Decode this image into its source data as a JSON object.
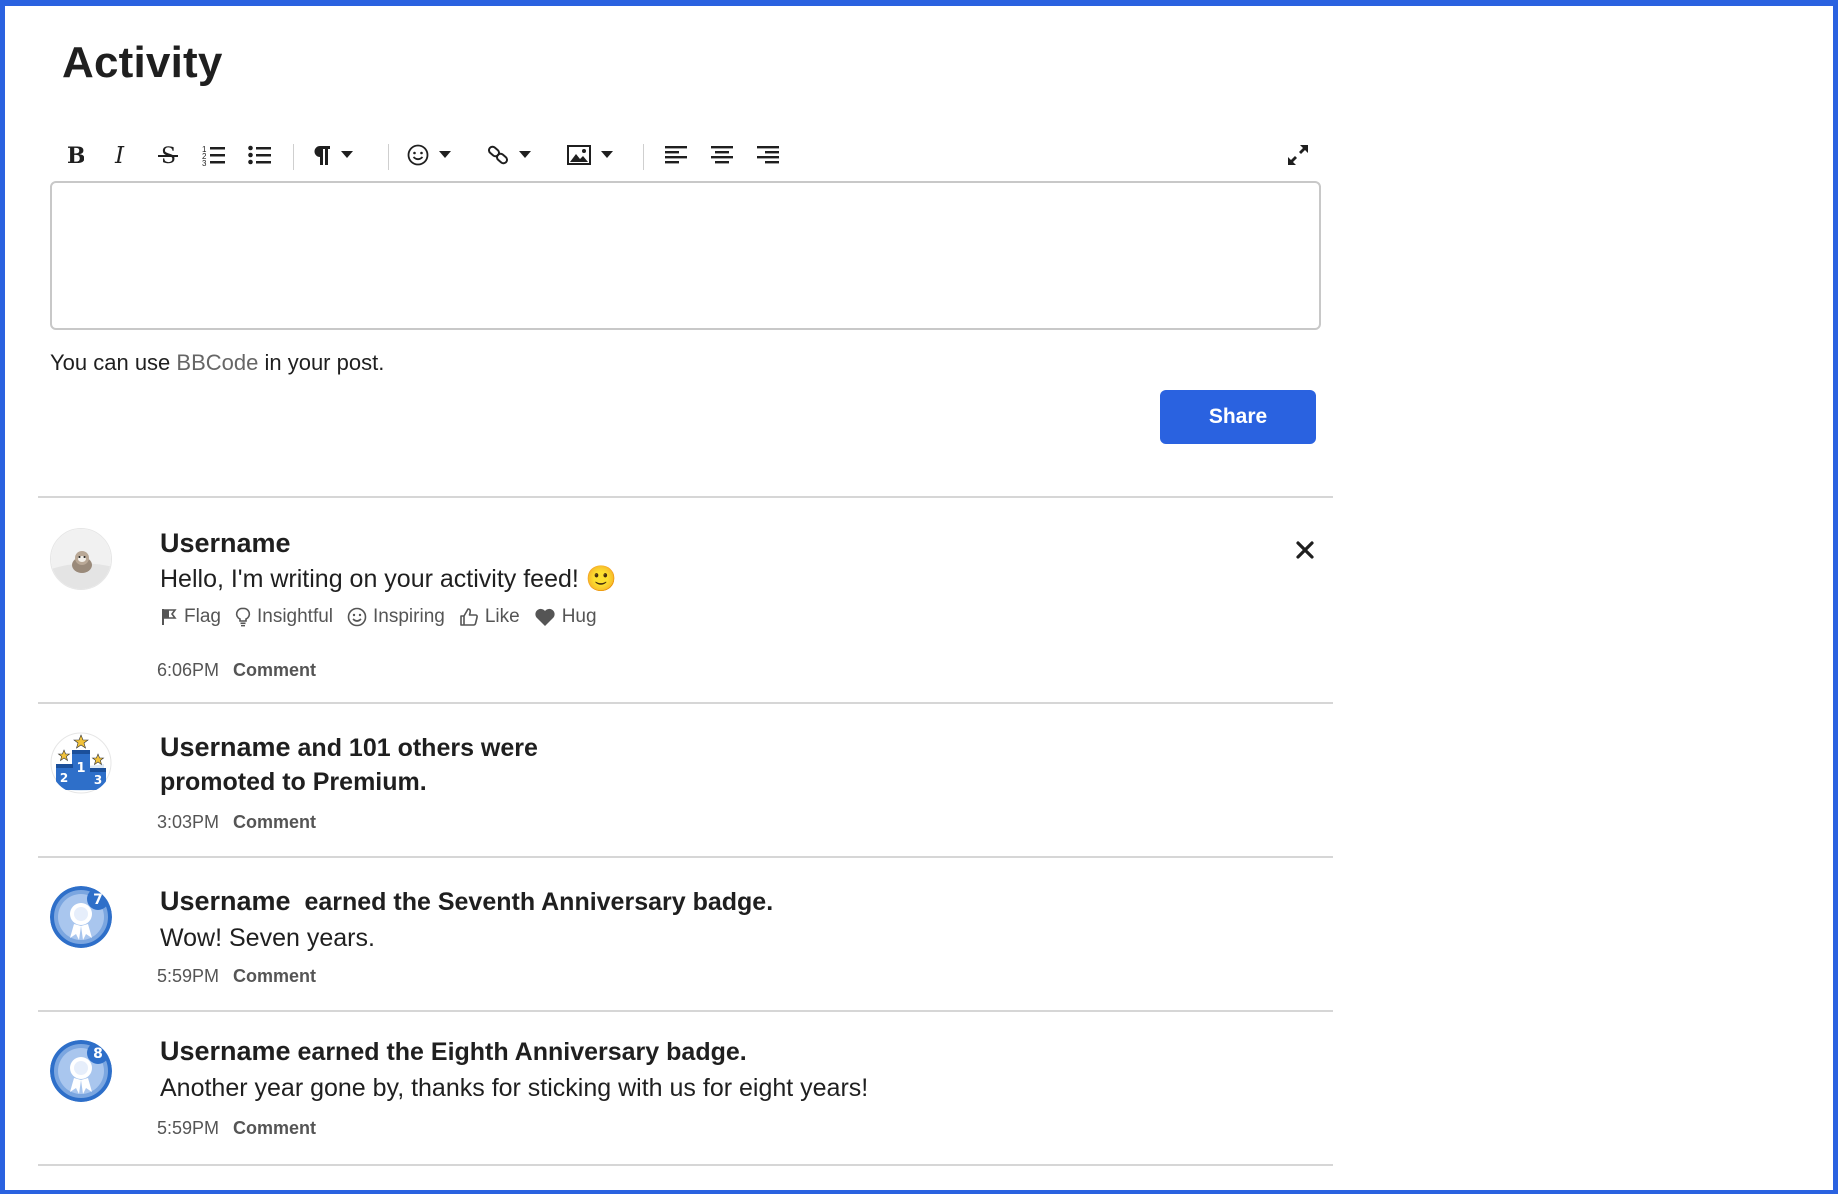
{
  "page": {
    "title": "Activity"
  },
  "toolbar": {
    "buttons": [
      "bold-icon",
      "italic-icon",
      "strikethrough-icon",
      "ordered-list-icon",
      "bullet-list-icon",
      "paragraph-icon",
      "emoji-icon",
      "link-icon",
      "image-icon",
      "align-left-icon",
      "align-center-icon",
      "align-right-icon",
      "expand-icon"
    ]
  },
  "composer": {
    "placeholder": "",
    "hint_prefix": "You can use ",
    "hint_link": "BBCode",
    "hint_suffix": " in your post.",
    "share_label": "Share"
  },
  "feed": [
    {
      "username": "Username",
      "headline_rest": "",
      "message": "Hello, I'm writing on your activity feed! 🙂",
      "reactions": [
        "Flag",
        "Insightful",
        "Inspiring",
        "Like",
        "Hug"
      ],
      "time": "6:06PM",
      "comment_label": "Comment"
    },
    {
      "username": "Username",
      "headline_rest_line1": " and 101 others were",
      "headline_line2": "promoted to Premium.",
      "time": "3:03PM",
      "comment_label": "Comment"
    },
    {
      "username": "Username",
      "headline_rest": "  earned the Seventh Anniversary badge.",
      "message": "Wow! Seven years.",
      "badge_number": "7",
      "time": "5:59PM",
      "comment_label": "Comment"
    },
    {
      "username": "Username",
      "headline_rest": " earned the Eighth Anniversary badge.",
      "message": "Another year gone by, thanks for sticking with us for eight years!",
      "badge_number": "8",
      "time": "5:59PM",
      "comment_label": "Comment"
    }
  ],
  "colors": {
    "accent": "#2a62e0",
    "badge_blue": "#2e6fc9",
    "badge_light": "#7ba6e0",
    "star": "#f2c23a"
  }
}
